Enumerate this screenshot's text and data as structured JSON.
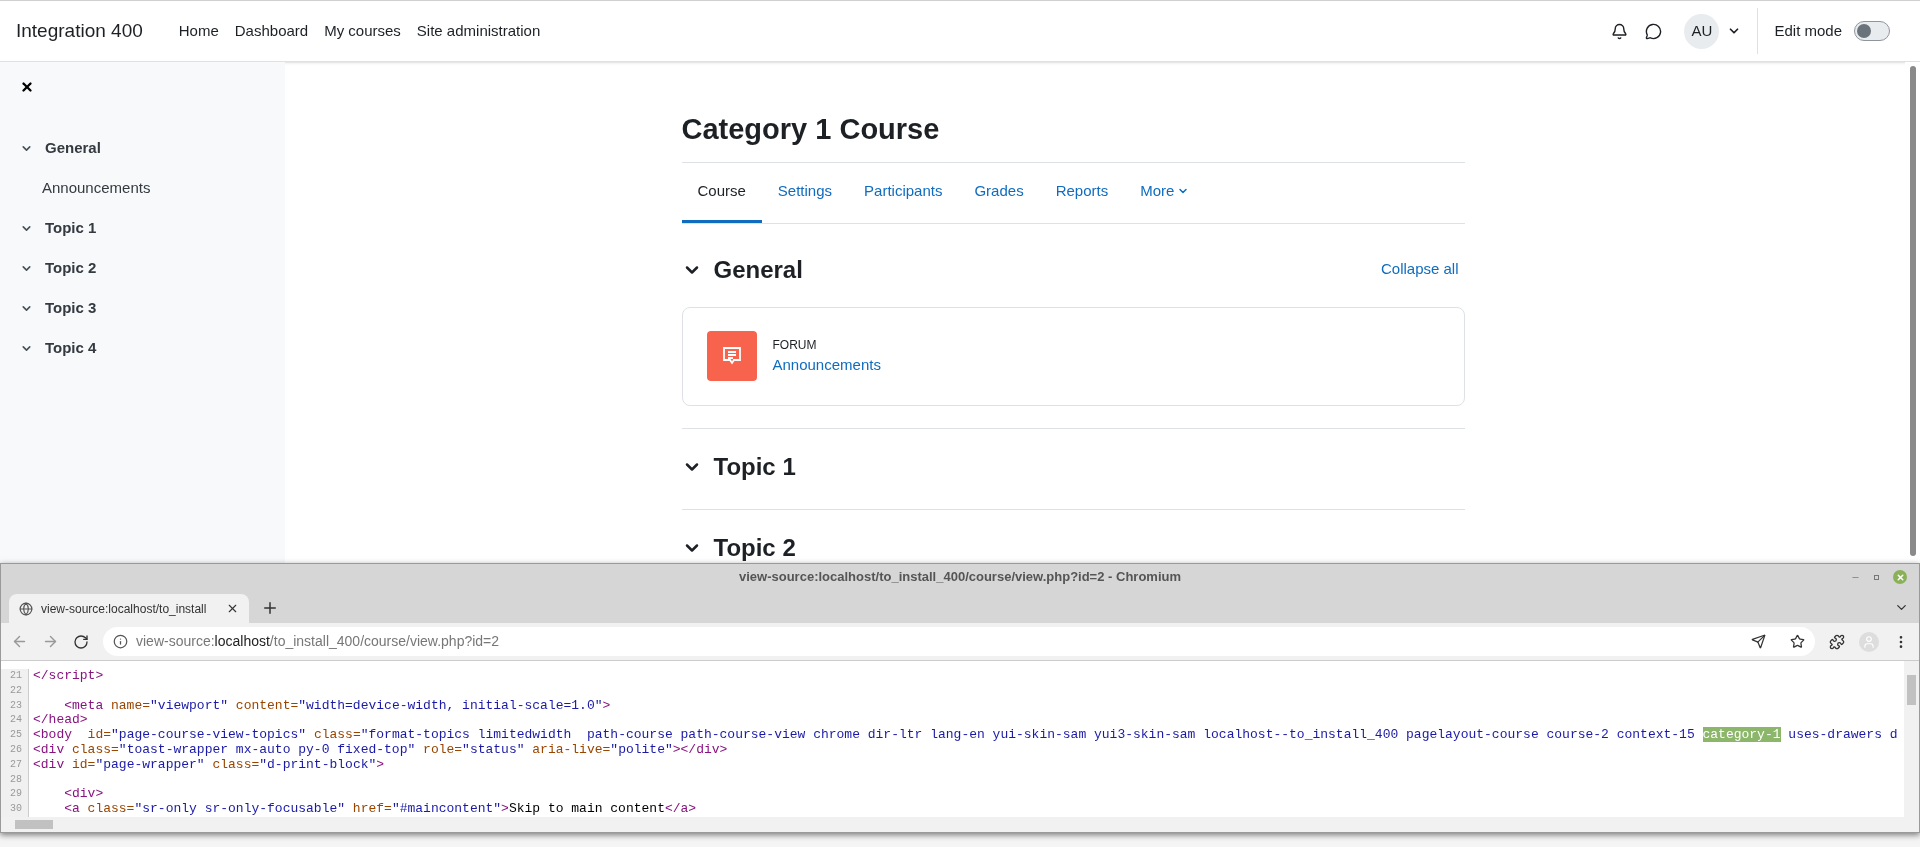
{
  "site": {
    "brand": "Integration 400",
    "nav": [
      {
        "label": "Home"
      },
      {
        "label": "Dashboard"
      },
      {
        "label": "My courses"
      },
      {
        "label": "Site administration"
      }
    ],
    "avatar": "AU",
    "edit_mode": {
      "label": "Edit mode",
      "on": false
    }
  },
  "drawer": {
    "items": [
      {
        "label": "General",
        "expanded": true,
        "children": [
          {
            "label": "Announcements"
          }
        ]
      },
      {
        "label": "Topic 1",
        "expanded": true
      },
      {
        "label": "Topic 2",
        "expanded": true
      },
      {
        "label": "Topic 3",
        "expanded": true
      },
      {
        "label": "Topic 4",
        "expanded": true
      }
    ]
  },
  "course": {
    "title": "Category 1 Course",
    "tabs": [
      {
        "label": "Course",
        "selected": true
      },
      {
        "label": "Settings",
        "selected": false
      },
      {
        "label": "Participants",
        "selected": false
      },
      {
        "label": "Grades",
        "selected": false
      },
      {
        "label": "Reports",
        "selected": false
      },
      {
        "label": "More",
        "selected": false,
        "kind": "menu"
      }
    ],
    "collapse_all": "Collapse all",
    "sections": [
      {
        "title": "General",
        "expanded": true,
        "activities": [
          {
            "type": "FORUM",
            "name": "Announcements"
          }
        ]
      },
      {
        "title": "Topic 1",
        "expanded": true
      },
      {
        "title": "Topic 2",
        "expanded": true
      }
    ]
  },
  "browser": {
    "title": "view-source:localhost/to_install_400/course/view.php?id=2 - Chromium",
    "tab": "view-source:localhost/to_install",
    "url": {
      "scheme": "view-source:",
      "host": "localhost",
      "path": "/to_install_400/course/view.php?id=2"
    },
    "lines": [
      {
        "number": "21",
        "segments": [
          {
            "kind": "tag",
            "text": "</script>"
          }
        ]
      },
      {
        "number": "22"
      },
      {
        "number": "23",
        "segments": [
          {
            "kind": "tag",
            "text": "    <meta"
          },
          {
            "kind": "attr",
            "text": " name="
          },
          {
            "kind": "value",
            "text": "\"viewport\""
          },
          {
            "kind": "attr",
            "text": " content="
          },
          {
            "kind": "value",
            "text": "\"width=device-width, initial-scale=1.0\""
          },
          {
            "kind": "tag",
            "text": ">"
          }
        ]
      },
      {
        "number": "24",
        "segments": [
          {
            "kind": "tag",
            "text": "</head>"
          }
        ]
      },
      {
        "number": "25",
        "segments": [
          {
            "kind": "tag",
            "text": "<body"
          },
          {
            "kind": "attr",
            "text": "  id="
          },
          {
            "kind": "value",
            "text": "\"page-course-view-topics\""
          },
          {
            "kind": "attr",
            "text": " class="
          },
          {
            "kind": "value",
            "text": "\"format-topics limitedwidth  path-course path-course-view chrome dir-ltr lang-en yui-skin-sam yui3-skin-sam localhost--to_install_400 pagelayout-course course-2 context-15 "
          },
          {
            "kind": "highlight",
            "text": "category-1"
          },
          {
            "kind": "value",
            "text": " uses-drawers d"
          }
        ]
      },
      {
        "number": "26",
        "segments": [
          {
            "kind": "tag",
            "text": "<div"
          },
          {
            "kind": "attr",
            "text": " class="
          },
          {
            "kind": "value",
            "text": "\"toast-wrapper mx-auto py-0 fixed-top\""
          },
          {
            "kind": "attr",
            "text": " role="
          },
          {
            "kind": "value",
            "text": "\"status\""
          },
          {
            "kind": "attr",
            "text": " aria-live="
          },
          {
            "kind": "value",
            "text": "\"polite\""
          },
          {
            "kind": "tag",
            "text": "></div>"
          }
        ]
      },
      {
        "number": "27",
        "segments": [
          {
            "kind": "tag",
            "text": "<div"
          },
          {
            "kind": "attr",
            "text": " id="
          },
          {
            "kind": "value",
            "text": "\"page-wrapper\""
          },
          {
            "kind": "attr",
            "text": " class="
          },
          {
            "kind": "value",
            "text": "\"d-print-block\""
          },
          {
            "kind": "tag",
            "text": ">"
          }
        ]
      },
      {
        "number": "28"
      },
      {
        "number": "29",
        "segments": [
          {
            "kind": "tag",
            "text": "    <div>"
          }
        ]
      },
      {
        "number": "30",
        "segments": [
          {
            "kind": "tag",
            "text": "    <a"
          },
          {
            "kind": "attr",
            "text": " class="
          },
          {
            "kind": "value",
            "text": "\"sr-only sr-only-focusable\""
          },
          {
            "kind": "attr",
            "text": " href="
          },
          {
            "kind": "value",
            "text": "\"#maincontent\""
          },
          {
            "kind": "tag",
            "text": ">"
          },
          {
            "kind": "text",
            "text": "Skip to main content"
          },
          {
            "kind": "tag",
            "text": "</a>"
          }
        ]
      }
    ]
  }
}
